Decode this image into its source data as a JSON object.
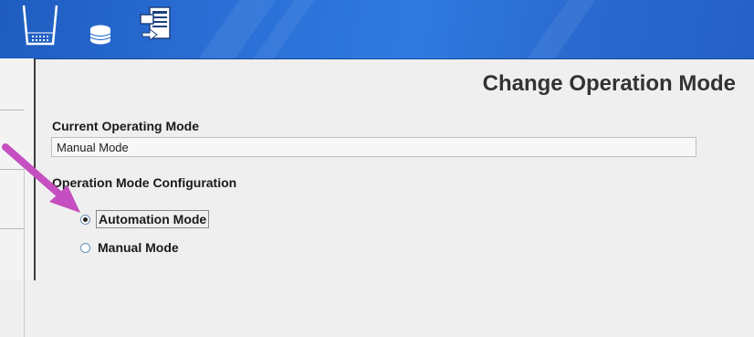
{
  "toolbar": {
    "icons": [
      "sample-tray-icon",
      "database-icon",
      "transfer-icon"
    ]
  },
  "page": {
    "title": "Change Operation Mode"
  },
  "current_mode": {
    "label": "Current Operating Mode",
    "value": "Manual Mode"
  },
  "configuration": {
    "label": "Operation Mode Configuration",
    "options": [
      {
        "label": "Automation Mode",
        "selected": true
      },
      {
        "label": "Manual Mode",
        "selected": false
      }
    ]
  },
  "colors": {
    "toolbar": "#2a6fd6",
    "annotation_arrow": "#c54fc0"
  }
}
